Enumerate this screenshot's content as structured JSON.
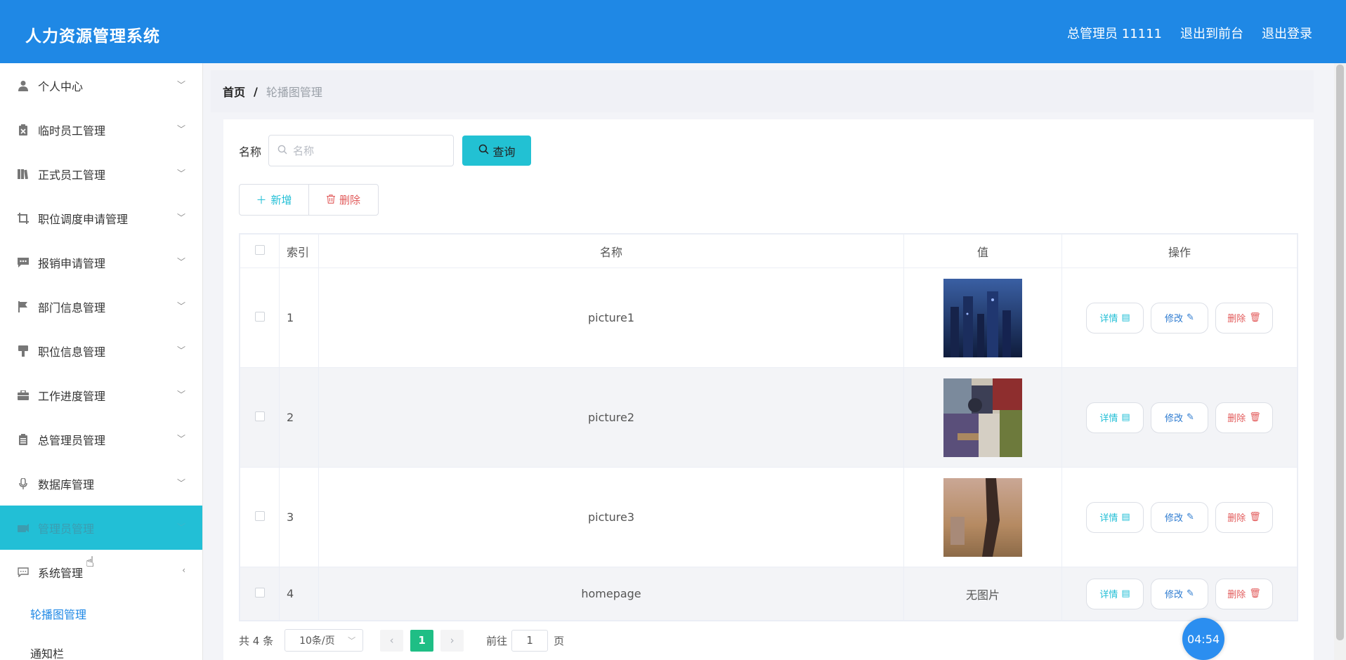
{
  "app": {
    "title": "人力资源管理系统",
    "user": "总管理员 11111",
    "to_front": "退出到前台",
    "logout": "退出登录"
  },
  "sidebar": {
    "items": [
      {
        "label": "个人中心",
        "icon": "user-icon"
      },
      {
        "label": "临时员工管理",
        "icon": "clipboard-x-icon"
      },
      {
        "label": "正式员工管理",
        "icon": "books-icon"
      },
      {
        "label": "职位调度申请管理",
        "icon": "crop-icon"
      },
      {
        "label": "报销申请管理",
        "icon": "chat-icon"
      },
      {
        "label": "部门信息管理",
        "icon": "flag-icon"
      },
      {
        "label": "职位信息管理",
        "icon": "brush-icon"
      },
      {
        "label": "工作进度管理",
        "icon": "briefcase-icon"
      },
      {
        "label": "总管理员管理",
        "icon": "clipboard-icon"
      },
      {
        "label": "数据库管理",
        "icon": "microphone-icon"
      },
      {
        "label": "管理员管理",
        "icon": "tag-icon"
      },
      {
        "label": "系统管理",
        "icon": "message-icon"
      }
    ],
    "sub_items": [
      "轮播图管理",
      "通知栏"
    ]
  },
  "breadcrumb": {
    "home": "首页",
    "sep": "/",
    "current": "轮播图管理"
  },
  "search": {
    "label": "名称",
    "placeholder": "名称",
    "button": "查询"
  },
  "actions": {
    "add": "新增",
    "delete": "删除"
  },
  "table": {
    "headers": [
      "索引",
      "名称",
      "值",
      "操作"
    ],
    "rows": [
      {
        "index": "1",
        "name": "picture1",
        "value": ""
      },
      {
        "index": "2",
        "name": "picture2",
        "value": ""
      },
      {
        "index": "3",
        "name": "picture3",
        "value": ""
      },
      {
        "index": "4",
        "name": "homepage",
        "value": "无图片"
      }
    ],
    "ops": {
      "detail": "详情",
      "edit": "修改",
      "remove": "删除"
    }
  },
  "pager": {
    "total": "共 4 条",
    "page_size": "10条/页",
    "current_page": "1",
    "goto_label": "前往",
    "goto_value": "1",
    "page_unit": "页"
  },
  "timer": "04:54",
  "colors": {
    "header": "#1f88e5",
    "accent": "#22bfd6",
    "danger": "#e25a5a",
    "pager_active": "#1fbe85"
  }
}
